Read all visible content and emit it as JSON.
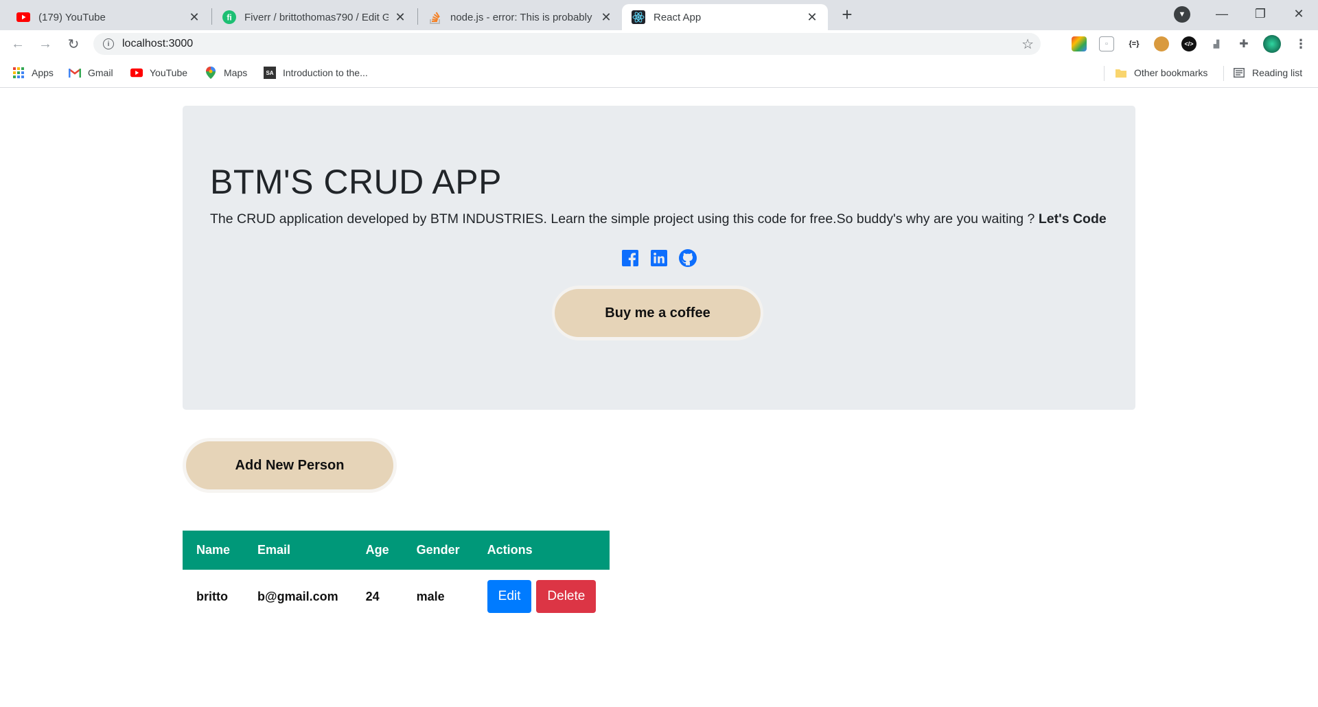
{
  "browser": {
    "tabs": [
      {
        "title": "(179) YouTube",
        "favicon": "youtube-icon",
        "active": false
      },
      {
        "title": "Fiverr / brittothomas790 / Edit Gi",
        "favicon": "fiverr-icon",
        "active": false
      },
      {
        "title": "node.js - error: This is probably n",
        "favicon": "stackoverflow-icon",
        "active": false
      },
      {
        "title": "React App",
        "favicon": "react-icon",
        "active": true
      }
    ],
    "url": "localhost:3000",
    "bookmarks": [
      {
        "label": "Apps",
        "icon": "apps-grid-icon"
      },
      {
        "label": "Gmail",
        "icon": "gmail-icon"
      },
      {
        "label": "YouTube",
        "icon": "youtube-icon"
      },
      {
        "label": "Maps",
        "icon": "maps-pin-icon"
      },
      {
        "label": "Introduction to the...",
        "icon": "site-icon"
      }
    ],
    "other_bookmarks": "Other bookmarks",
    "reading_list": "Reading list"
  },
  "hero": {
    "title": "BTM'S CRUD APP",
    "lead": "The CRUD application developed by BTM INDUSTRIES. Learn the simple project using this code for free.So buddy's why are you waiting ? ",
    "lead_bold": "Let's Code",
    "coffee_label": "Buy me a coffee"
  },
  "add_button": "Add New Person",
  "table": {
    "headers": [
      "Name",
      "Email",
      "Age",
      "Gender",
      "Actions"
    ],
    "rows": [
      {
        "name": "britto",
        "email": "b@gmail.com",
        "age": "24",
        "gender": "male",
        "edit": "Edit",
        "delete": "Delete"
      }
    ]
  },
  "colors": {
    "header_teal": "#009879",
    "button_beige": "#e6d4b8",
    "edit_blue": "#007bff",
    "delete_red": "#dc3545",
    "jumbotron": "#e9ecef",
    "social_blue": "#0d6efd"
  }
}
